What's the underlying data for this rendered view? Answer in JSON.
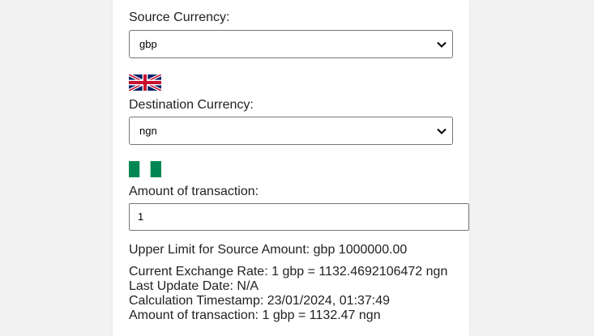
{
  "form": {
    "source_label": "Source Currency:",
    "source_value": "gbp",
    "destination_label": "Destination Currency:",
    "destination_value": "ngn",
    "amount_label": "Amount of transaction:",
    "amount_value": "1"
  },
  "results": {
    "upper_limit": "Upper Limit for Source Amount: gbp 1000000.00",
    "exchange_rate": "Current Exchange Rate: 1 gbp = 1132.4692106472 ngn",
    "last_update": "Last Update Date: N/A",
    "calc_timestamp": "Calculation Timestamp: 23/01/2024, 01:37:49",
    "amount_result": "Amount of transaction: 1 gbp = 1132.47 ngn"
  },
  "icons": {
    "source_flag": "uk-flag-icon",
    "destination_flag": "nigeria-flag-icon",
    "select_arrow": "chevron-down-icon"
  },
  "colors": {
    "uk_blue": "#012169",
    "uk_red": "#C8102E",
    "nigeria_green": "#008751"
  }
}
